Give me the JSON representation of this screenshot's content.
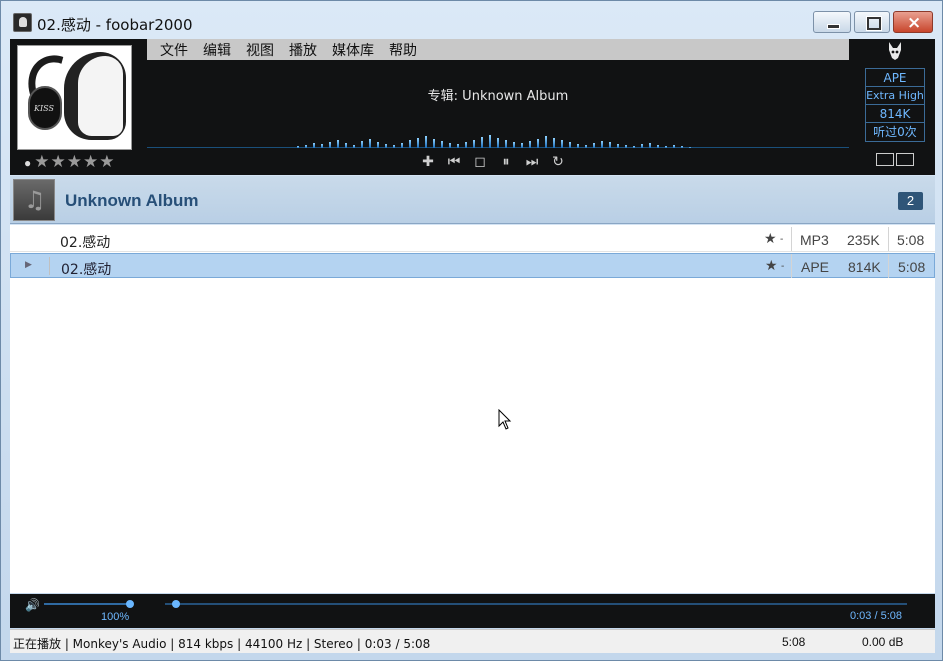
{
  "window": {
    "title": "02.感动 - foobar2000"
  },
  "menu": {
    "items": [
      "文件",
      "编辑",
      "视图",
      "播放",
      "媒体库",
      "帮助"
    ]
  },
  "now_playing": {
    "album_line": "专辑: Unknown Album",
    "rating_stars": "★★★★★",
    "cover_text": "KISS"
  },
  "info": {
    "codec": "APE",
    "profile": "Extra High",
    "bitrate": "814K",
    "play_count": "听过0次"
  },
  "controls": [
    "add-icon",
    "previous-icon",
    "stop-icon",
    "pause-icon",
    "next-icon",
    "repeat-icon"
  ],
  "group": {
    "title": "Unknown Album",
    "count": "2"
  },
  "playlist": {
    "rows": [
      {
        "title": "02.感动",
        "rating": "★",
        "rating_dash": "-",
        "codec": "MP3",
        "bitrate": "235K",
        "length": "5:08",
        "selected": false
      },
      {
        "title": "02.感动",
        "rating": "★",
        "rating_dash": "-",
        "codec": "APE",
        "bitrate": "814K",
        "length": "5:08",
        "selected": true
      }
    ]
  },
  "seek": {
    "volume_label": "100%",
    "volume_fraction": 1.0,
    "time_label": "0:03 / 5:08",
    "position_fraction": 0.01
  },
  "status": {
    "text": "正在播放 | Monkey's Audio | 814 kbps | 44100 Hz | Stereo | 0:03 / 5:08",
    "length": "5:08",
    "gain": "0.00 dB"
  },
  "colors": {
    "accent": "#6fb8ff",
    "selection": "#b4d3f1",
    "dark_panel": "#111213"
  }
}
